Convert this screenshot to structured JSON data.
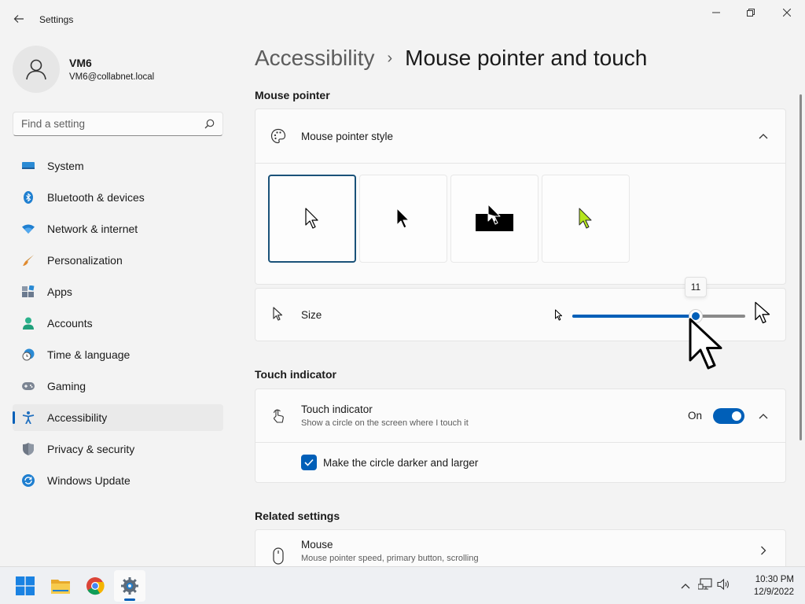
{
  "window": {
    "title": "Settings"
  },
  "profile": {
    "name": "VM6",
    "email": "VM6@collabnet.local"
  },
  "search": {
    "placeholder": "Find a setting"
  },
  "nav": {
    "items": [
      {
        "label": "System",
        "icon": "system-icon",
        "active": false
      },
      {
        "label": "Bluetooth & devices",
        "icon": "bluetooth-icon",
        "active": false
      },
      {
        "label": "Network & internet",
        "icon": "wifi-icon",
        "active": false
      },
      {
        "label": "Personalization",
        "icon": "brush-icon",
        "active": false
      },
      {
        "label": "Apps",
        "icon": "apps-icon",
        "active": false
      },
      {
        "label": "Accounts",
        "icon": "person-icon",
        "active": false
      },
      {
        "label": "Time & language",
        "icon": "clock-globe-icon",
        "active": false
      },
      {
        "label": "Gaming",
        "icon": "gamepad-icon",
        "active": false
      },
      {
        "label": "Accessibility",
        "icon": "accessibility-icon",
        "active": true
      },
      {
        "label": "Privacy & security",
        "icon": "shield-icon",
        "active": false
      },
      {
        "label": "Windows Update",
        "icon": "update-icon",
        "active": false
      }
    ]
  },
  "breadcrumb": {
    "parent": "Accessibility",
    "separator": "›",
    "current": "Mouse pointer and touch"
  },
  "mouse_pointer": {
    "heading": "Mouse pointer",
    "style_title": "Mouse pointer style",
    "style_options": [
      "white",
      "black",
      "inverted",
      "custom"
    ],
    "selected_style": "white",
    "custom_color": "#b5e61d",
    "size_label": "Size",
    "size_value": "11",
    "size_min": 1,
    "size_max": 15
  },
  "touch": {
    "heading": "Touch indicator",
    "title": "Touch indicator",
    "subtitle": "Show a circle on the screen where I touch it",
    "state_label": "On",
    "enabled": true,
    "darker_label": "Make the circle darker and larger",
    "darker_checked": true
  },
  "related": {
    "heading": "Related settings",
    "mouse_title": "Mouse",
    "mouse_subtitle": "Mouse pointer speed, primary button, scrolling"
  },
  "taskbar": {
    "apps": [
      "start-icon",
      "file-explorer-icon",
      "chrome-icon",
      "settings-icon"
    ],
    "time": "10:30 PM",
    "date": "12/9/2022"
  },
  "colors": {
    "accent": "#005fb8",
    "selected_border": "#1a5279"
  }
}
